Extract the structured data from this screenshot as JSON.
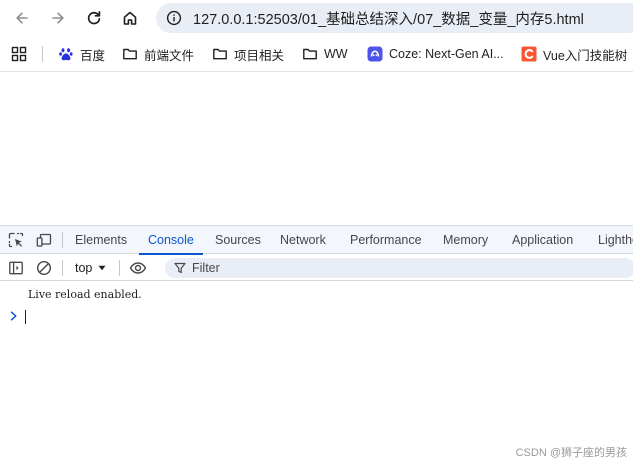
{
  "browser": {
    "url": "127.0.0.1:52503/01_基础总结深入/07_数据_变量_内存5.html",
    "icons": {
      "back": "arrow-left-icon",
      "forward": "arrow-right-icon",
      "reload": "reload-icon",
      "home": "home-icon",
      "site_info": "site-info-icon"
    }
  },
  "bookmarks": [
    {
      "label": "百度",
      "icon": "baidu-paw-icon",
      "color": "#2932e1"
    },
    {
      "label": "前端文件",
      "icon": "folder-icon"
    },
    {
      "label": "项目相关",
      "icon": "folder-icon"
    },
    {
      "label": "WW",
      "icon": "folder-icon"
    },
    {
      "label": "Coze: Next-Gen AI...",
      "icon": "coze-icon",
      "color": "#4d53e8"
    },
    {
      "label": "Vue入门技能树",
      "icon": "csdn-c-icon",
      "color": "#fc5531"
    }
  ],
  "devtools": {
    "tabs": [
      {
        "label": "Elements",
        "active": false
      },
      {
        "label": "Console",
        "active": true
      },
      {
        "label": "Sources",
        "active": false
      },
      {
        "label": "Network",
        "active": false
      },
      {
        "label": "Performance",
        "active": false
      },
      {
        "label": "Memory",
        "active": false
      },
      {
        "label": "Application",
        "active": false
      },
      {
        "label": "Lighthouse",
        "active": false
      }
    ],
    "accent_color": "#0b57d0",
    "console": {
      "context": "top",
      "filter_placeholder": "Filter",
      "filter_value": "",
      "messages": [
        "Live reload enabled."
      ]
    }
  },
  "watermark": "CSDN @狮子座的男孩"
}
